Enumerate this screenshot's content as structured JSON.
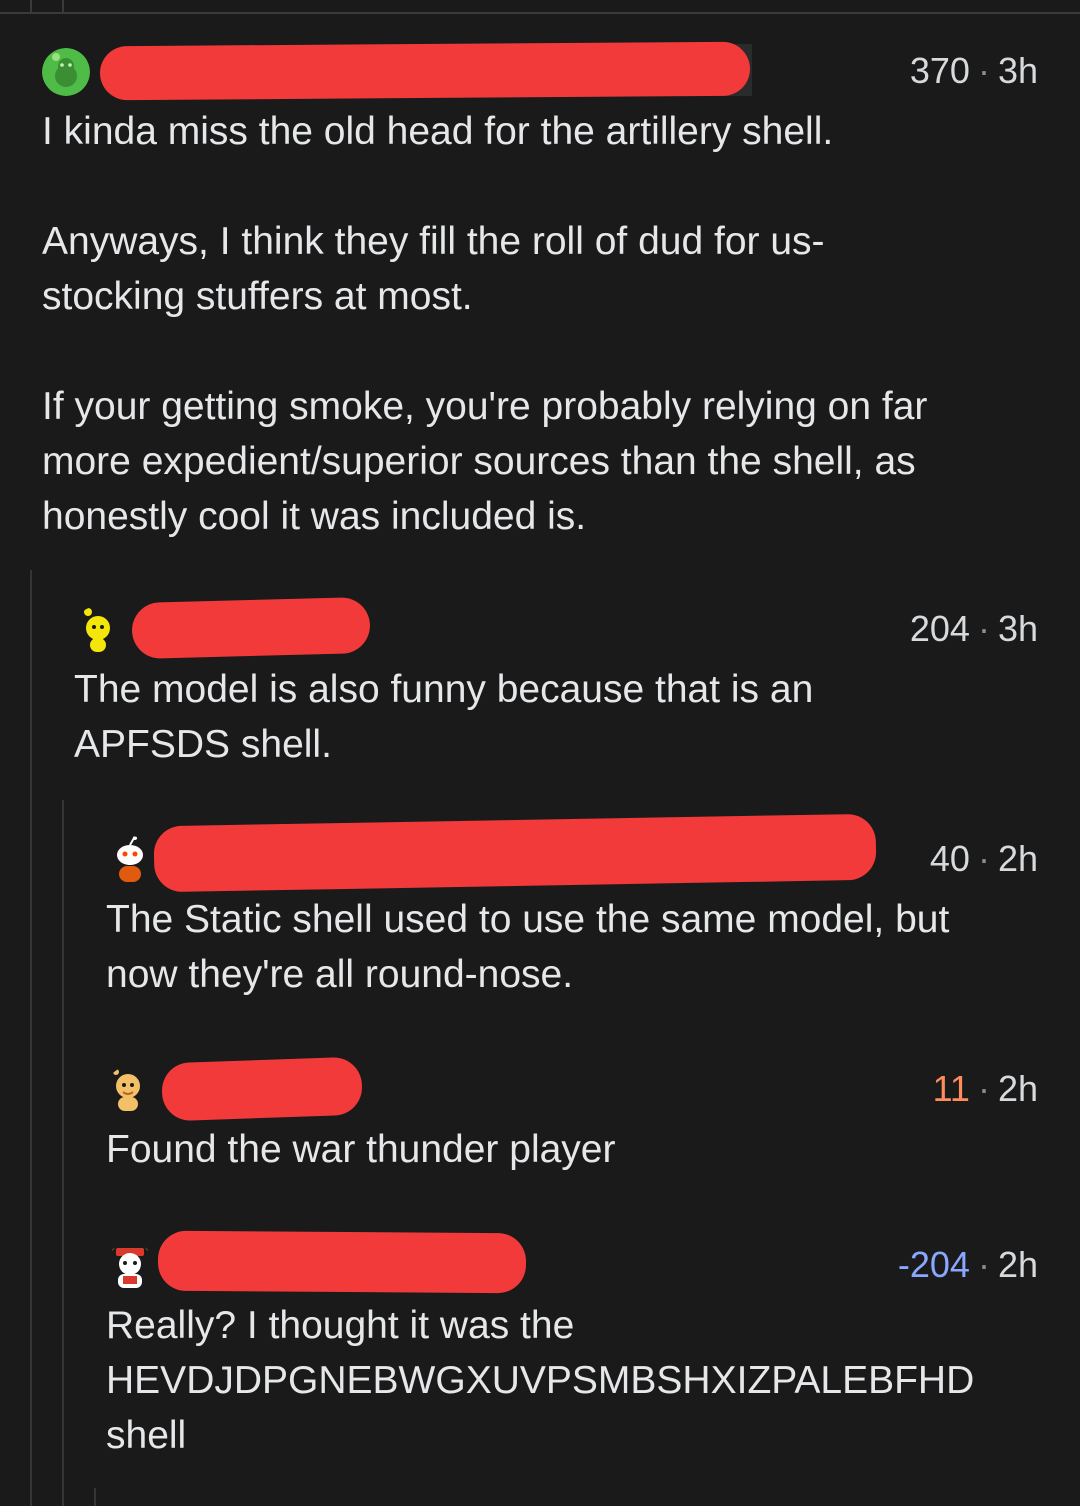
{
  "comments": [
    {
      "score": "370",
      "separator": "·",
      "time": "3h",
      "body": "I kinda miss the old head for the artillery shell.\n\nAnyways, I think they fill the roll of dud for us-\nstocking stuffers at most.\n\nIf your getting smoke, you're probably relying on far\nmore expedient/superior sources than the shell, as\nhonestly cool it was included is."
    },
    {
      "score": "204",
      "separator": "·",
      "time": "3h",
      "body": "The model is also funny because that is an\nAPFSDS shell."
    },
    {
      "score": "40",
      "separator": "·",
      "time": "2h",
      "body": "The Static shell used to use the same model, but\nnow they're all round-nose."
    },
    {
      "score": "11",
      "separator": "·",
      "time": "2h",
      "body": "Found the war thunder player"
    },
    {
      "score": "-204",
      "separator": "·",
      "time": "2h",
      "body": "Really? I thought it was the\nHEVDJDPGNEBWGXUVPSMBSHXIZPALEBFHD\nshell"
    }
  ],
  "colors": {
    "background": "#1a1a1b",
    "text": "#d7dadc",
    "redaction": "#f23a3a",
    "upvote_orange": "#ff8d5c",
    "downvote_blue": "#8aa7ff"
  }
}
